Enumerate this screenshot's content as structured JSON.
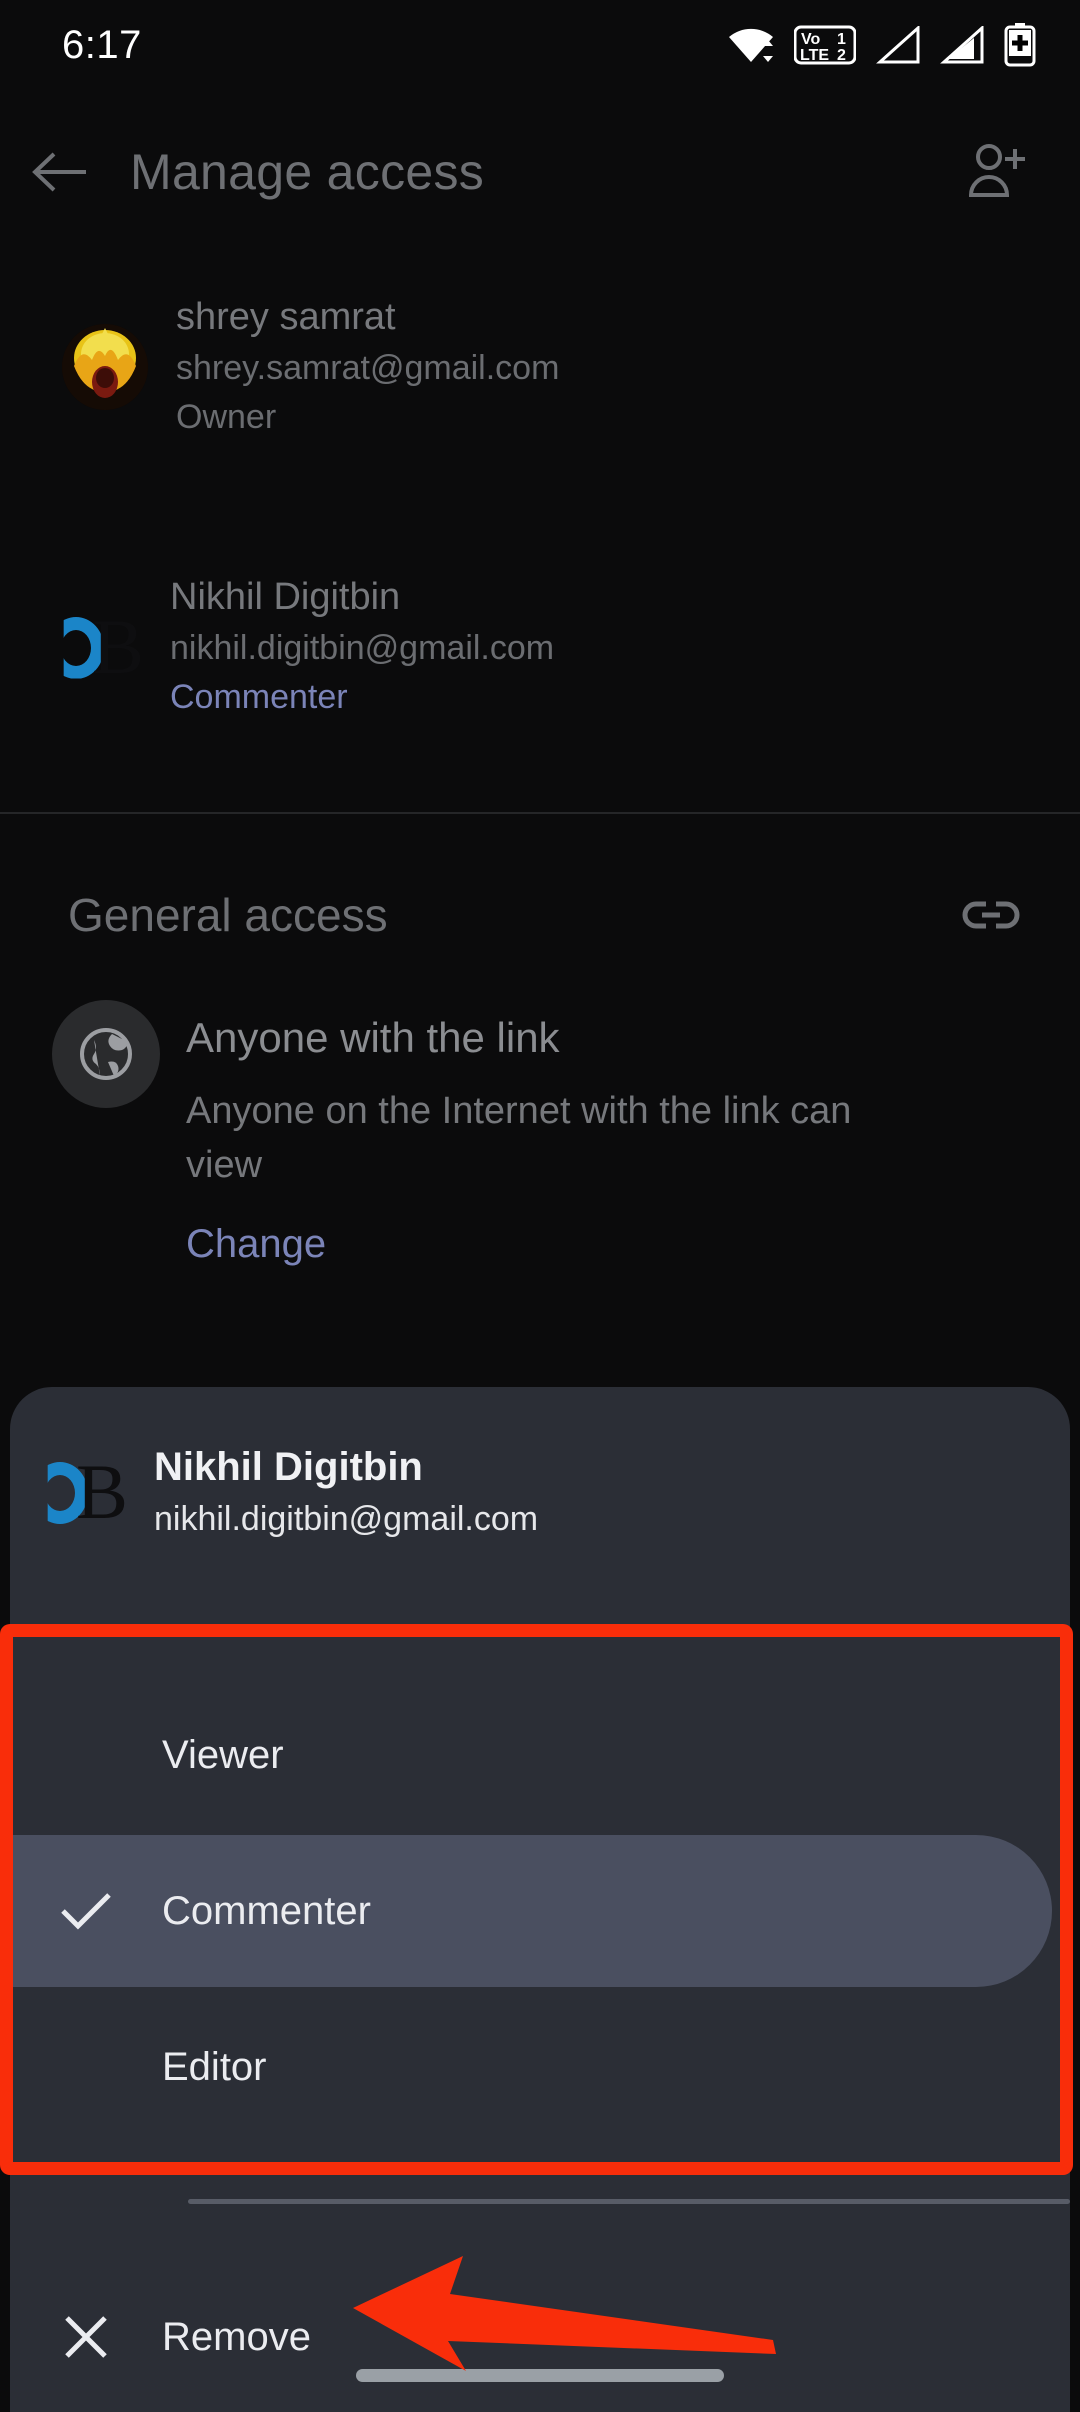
{
  "status_bar": {
    "time": "6:17",
    "icons": [
      "wifi-icon",
      "volte-dual-sim-icon",
      "signal-sim1-icon",
      "signal-sim2-icon",
      "battery-saver-icon"
    ],
    "volte_label_top": "Vo",
    "volte_label_bottom": "LTE",
    "sim1": "1",
    "sim2": "2"
  },
  "app_bar": {
    "back_icon": "arrow-back-icon",
    "title": "Manage access",
    "add_person_icon": "person-add-icon"
  },
  "people": [
    {
      "name": "shrey samrat",
      "email": "shrey.samrat@gmail.com",
      "role": "Owner",
      "role_is_link": false,
      "avatar": "flame-photo-avatar"
    },
    {
      "name": "Nikhil Digitbin",
      "email": "nikhil.digitbin@gmail.com",
      "role": "Commenter",
      "role_is_link": true,
      "avatar": "db-logo-avatar"
    }
  ],
  "general_access": {
    "section_title": "General access",
    "link_icon": "link-chain-icon",
    "globe_icon": "globe-icon",
    "name": "Anyone with the link",
    "description": "Anyone on the Internet with the link can view",
    "change_label": "Change"
  },
  "sheet": {
    "user_name": "Nikhil Digitbin",
    "user_email": "nikhil.digitbin@gmail.com",
    "avatar": "db-logo-avatar",
    "options": [
      {
        "label": "Viewer",
        "selected": false
      },
      {
        "label": "Commenter",
        "selected": true
      },
      {
        "label": "Editor",
        "selected": false
      }
    ],
    "check_icon": "check-icon",
    "remove_icon": "close-x-icon",
    "remove_label": "Remove"
  },
  "annotations": {
    "highlight_box_color": "#f92d0a",
    "arrow_color": "#f92d0a",
    "arrow_icon": "arrow-left-annotation",
    "box_icon": "highlight-rectangle-annotation"
  },
  "colors": {
    "screen_background": "#0b0b0c",
    "sheet_background": "#2b2e36",
    "selected_row": "#4a4f60",
    "link_text": "#7b84b8",
    "accent_red": "#f92d0a"
  }
}
